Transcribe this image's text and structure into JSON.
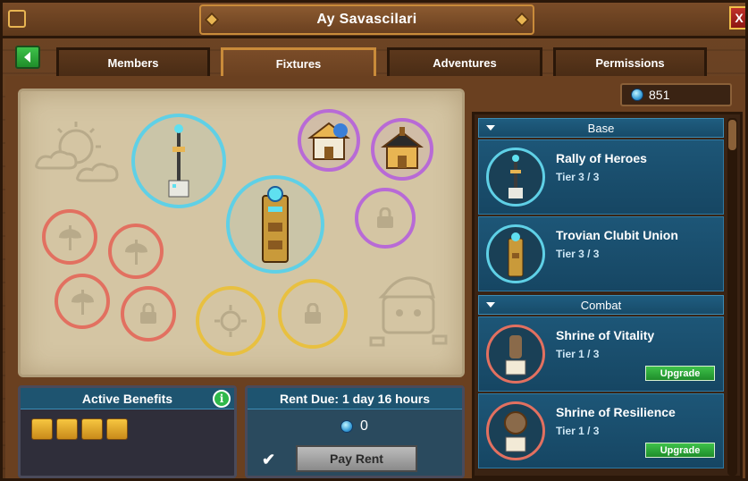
{
  "window": {
    "title": "Ay Savascilari",
    "close_label": "X"
  },
  "tabs": [
    {
      "label": "Members",
      "active": false
    },
    {
      "label": "Fixtures",
      "active": true
    },
    {
      "label": "Adventures",
      "active": false
    },
    {
      "label": "Permissions",
      "active": false
    }
  ],
  "currency": {
    "value": "851",
    "icon": "gem-icon"
  },
  "fixtures_list": {
    "sections": [
      {
        "title": "Base",
        "items": [
          {
            "name": "Rally of Heroes",
            "tier": "Tier 3 / 3"
          },
          {
            "name": "Trovian Clubit Union",
            "tier": "Tier 3 / 3"
          }
        ]
      },
      {
        "title": "Combat",
        "items": [
          {
            "name": "Shrine of Vitality",
            "tier": "Tier 1 / 3",
            "button": "Upgrade"
          },
          {
            "name": "Shrine of Resilience",
            "tier": "Tier 1 / 3",
            "button": "Upgrade"
          }
        ]
      }
    ]
  },
  "benefits": {
    "title": "Active Benefits",
    "info_label": "i"
  },
  "rent": {
    "title": "Rent Due: 1 day 16 hours",
    "amount": "0",
    "button": "Pay Rent"
  },
  "colors": {
    "slot_blue": "#5fd0e6",
    "slot_purple": "#b86ad6",
    "slot_red": "#e27060",
    "slot_gold": "#e8c040",
    "upgrade_green": "#2fae3c"
  }
}
